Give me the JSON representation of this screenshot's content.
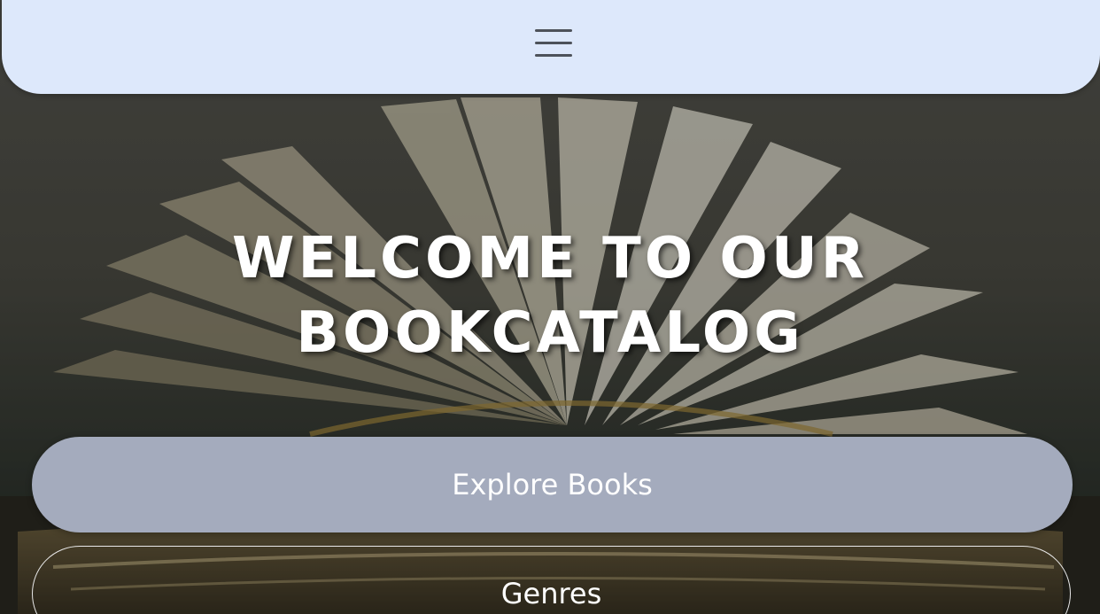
{
  "navbar": {
    "menu_icon": "hamburger-menu-icon"
  },
  "hero": {
    "title_line1": "WELCOME TO OUR",
    "title_line2": "BOOKCATALOG",
    "background": "open-book-photo"
  },
  "buttons": {
    "explore_label": "Explore Books",
    "genres_label": "Genres"
  },
  "colors": {
    "navbar_bg": "#dde8fb",
    "explore_bg": "#a4abbd",
    "text": "#ffffff"
  }
}
